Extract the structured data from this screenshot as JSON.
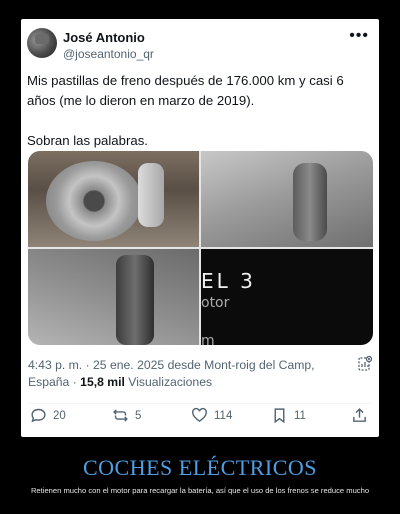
{
  "tweet": {
    "author_name": "José Antonio",
    "author_handle": "@joseantonio_qr",
    "text_line1": "Mis pastillas de freno después de 176.000 km y casi 6 años (me lo dieron en marzo de 2019).",
    "text_line2": "Sobran las palabras.",
    "timestamp": "4:43 p. m. · 25 ene. 2025 desde Mont-roig del Camp, España · ",
    "views_count": "15,8 mil",
    "views_label": "Visualizaciones",
    "media_text": {
      "line1": "EL 3",
      "line2": "otor",
      "line3": "m"
    }
  },
  "actions": {
    "replies": "20",
    "retweets": "5",
    "likes": "114",
    "bookmarks": "11"
  },
  "icons": {
    "more": "more-options-icon",
    "stats": "stats-icon",
    "reply": "reply-icon",
    "retweet": "retweet-icon",
    "like": "heart-icon",
    "bookmark": "bookmark-icon",
    "share": "share-icon"
  },
  "caption": {
    "title": "COCHES ELÉCTRICOS",
    "subtitle": "Retienen mucho con el motor para recargar la batería, así que el uso de los frenos se reduce mucho",
    "title_color": "#4e9fe3"
  }
}
